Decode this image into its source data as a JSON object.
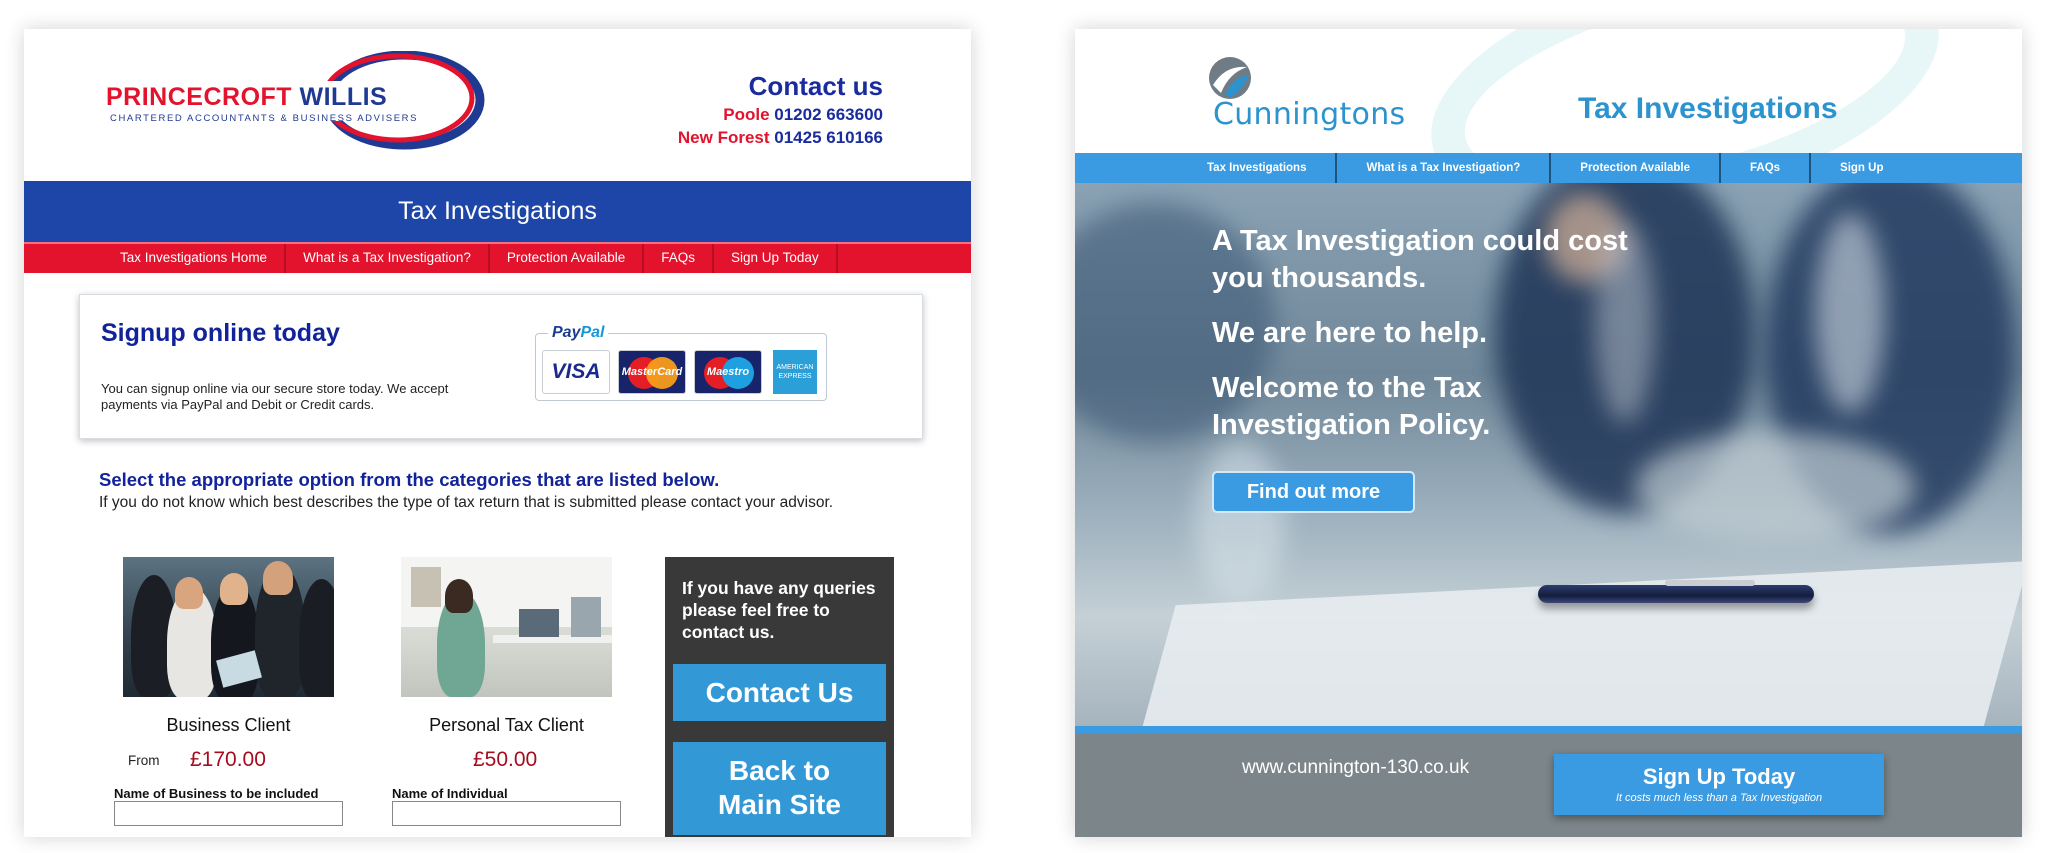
{
  "left": {
    "logo": {
      "name_red": "PRINCECROFT",
      "name_blue": "WILLIS",
      "tagline": "CHARTERED ACCOUNTANTS & BUSINESS ADVISERS"
    },
    "contact": {
      "title": "Contact us",
      "lines": [
        {
          "location": "Poole",
          "number": "01202 663600"
        },
        {
          "location": "New Forest",
          "number": "01425 610166"
        }
      ]
    },
    "band_title": "Tax Investigations",
    "nav": [
      "Tax Investigations Home",
      "What is a Tax Investigation?",
      "Protection Available",
      "FAQs",
      "Sign Up Today"
    ],
    "signup": {
      "title": "Signup online today",
      "text": "You can signup online via our secure store today. We accept payments via PayPal and Debit or Credit cards.",
      "paypal_a": "Pay",
      "paypal_b": "Pal",
      "cards": [
        "VISA",
        "MasterCard",
        "Maestro",
        "AMERICAN EXPRESS"
      ]
    },
    "select": {
      "heading": "Select the appropriate option from the categories that are listed below.",
      "sub": "If you do not know which best describes the type of tax return that is submitted please contact your advisor."
    },
    "clients": [
      {
        "label": "Business Client",
        "prefix": "From",
        "price": "£170.00",
        "field_label": "Name of Business to be included"
      },
      {
        "label": "Personal Tax Client",
        "prefix": "",
        "price": "£50.00",
        "field_label": "Name of Individual"
      }
    ],
    "queries": {
      "text": "If you have any queries please feel free to contact us.",
      "contact_button": "Contact Us",
      "back_line1": "Back to",
      "back_line2": "Main Site"
    }
  },
  "right": {
    "logo_name": "Cunningtons",
    "title": "Tax Investigations",
    "nav": [
      "Tax Investigations",
      "What is a Tax Investigation?",
      "Protection Available",
      "FAQs",
      "Sign Up"
    ],
    "hero": {
      "line1": "A Tax Investigation could cost you thousands.",
      "line2": "We are here to help.",
      "line3": "Welcome to the Tax Investigation Policy.",
      "button": "Find out more"
    },
    "footer": {
      "url": "www.cunnington-130.co.uk",
      "signup_title": "Sign Up Today",
      "signup_sub": "It costs much less than a Tax Investigation"
    }
  },
  "colors": {
    "pw_red": "#e3122d",
    "pw_blue": "#1e45a8",
    "cun_blue": "#3a9be2",
    "footer_grey": "#7c868a"
  }
}
